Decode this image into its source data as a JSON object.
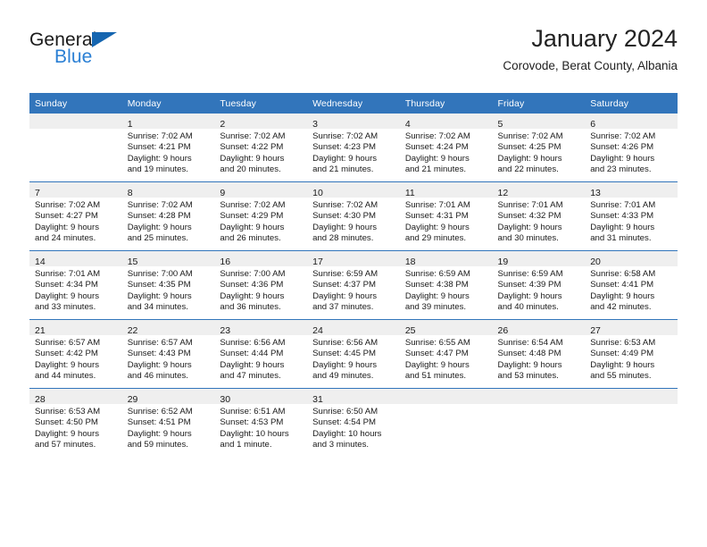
{
  "brand": {
    "name_part1": "General",
    "name_part2": "Blue",
    "triangle_icon": "triangle-icon",
    "blue": "#2a7fd4",
    "dark_blue": "#1565b0"
  },
  "header": {
    "title": "January 2024",
    "subtitle": "Corovode, Berat County, Albania"
  },
  "colors": {
    "header_blue": "#3275bb",
    "daynum_band": "#efefef",
    "text": "#1a1a1a"
  },
  "calendar": {
    "weekday_headers": [
      "Sunday",
      "Monday",
      "Tuesday",
      "Wednesday",
      "Thursday",
      "Friday",
      "Saturday"
    ],
    "weeks": [
      [
        {
          "day": "",
          "sunrise": "",
          "sunset": "",
          "daylight_line1": "",
          "daylight_line2": ""
        },
        {
          "day": "1",
          "sunrise": "Sunrise: 7:02 AM",
          "sunset": "Sunset: 4:21 PM",
          "daylight_line1": "Daylight: 9 hours",
          "daylight_line2": "and 19 minutes."
        },
        {
          "day": "2",
          "sunrise": "Sunrise: 7:02 AM",
          "sunset": "Sunset: 4:22 PM",
          "daylight_line1": "Daylight: 9 hours",
          "daylight_line2": "and 20 minutes."
        },
        {
          "day": "3",
          "sunrise": "Sunrise: 7:02 AM",
          "sunset": "Sunset: 4:23 PM",
          "daylight_line1": "Daylight: 9 hours",
          "daylight_line2": "and 21 minutes."
        },
        {
          "day": "4",
          "sunrise": "Sunrise: 7:02 AM",
          "sunset": "Sunset: 4:24 PM",
          "daylight_line1": "Daylight: 9 hours",
          "daylight_line2": "and 21 minutes."
        },
        {
          "day": "5",
          "sunrise": "Sunrise: 7:02 AM",
          "sunset": "Sunset: 4:25 PM",
          "daylight_line1": "Daylight: 9 hours",
          "daylight_line2": "and 22 minutes."
        },
        {
          "day": "6",
          "sunrise": "Sunrise: 7:02 AM",
          "sunset": "Sunset: 4:26 PM",
          "daylight_line1": "Daylight: 9 hours",
          "daylight_line2": "and 23 minutes."
        }
      ],
      [
        {
          "day": "7",
          "sunrise": "Sunrise: 7:02 AM",
          "sunset": "Sunset: 4:27 PM",
          "daylight_line1": "Daylight: 9 hours",
          "daylight_line2": "and 24 minutes."
        },
        {
          "day": "8",
          "sunrise": "Sunrise: 7:02 AM",
          "sunset": "Sunset: 4:28 PM",
          "daylight_line1": "Daylight: 9 hours",
          "daylight_line2": "and 25 minutes."
        },
        {
          "day": "9",
          "sunrise": "Sunrise: 7:02 AM",
          "sunset": "Sunset: 4:29 PM",
          "daylight_line1": "Daylight: 9 hours",
          "daylight_line2": "and 26 minutes."
        },
        {
          "day": "10",
          "sunrise": "Sunrise: 7:02 AM",
          "sunset": "Sunset: 4:30 PM",
          "daylight_line1": "Daylight: 9 hours",
          "daylight_line2": "and 28 minutes."
        },
        {
          "day": "11",
          "sunrise": "Sunrise: 7:01 AM",
          "sunset": "Sunset: 4:31 PM",
          "daylight_line1": "Daylight: 9 hours",
          "daylight_line2": "and 29 minutes."
        },
        {
          "day": "12",
          "sunrise": "Sunrise: 7:01 AM",
          "sunset": "Sunset: 4:32 PM",
          "daylight_line1": "Daylight: 9 hours",
          "daylight_line2": "and 30 minutes."
        },
        {
          "day": "13",
          "sunrise": "Sunrise: 7:01 AM",
          "sunset": "Sunset: 4:33 PM",
          "daylight_line1": "Daylight: 9 hours",
          "daylight_line2": "and 31 minutes."
        }
      ],
      [
        {
          "day": "14",
          "sunrise": "Sunrise: 7:01 AM",
          "sunset": "Sunset: 4:34 PM",
          "daylight_line1": "Daylight: 9 hours",
          "daylight_line2": "and 33 minutes."
        },
        {
          "day": "15",
          "sunrise": "Sunrise: 7:00 AM",
          "sunset": "Sunset: 4:35 PM",
          "daylight_line1": "Daylight: 9 hours",
          "daylight_line2": "and 34 minutes."
        },
        {
          "day": "16",
          "sunrise": "Sunrise: 7:00 AM",
          "sunset": "Sunset: 4:36 PM",
          "daylight_line1": "Daylight: 9 hours",
          "daylight_line2": "and 36 minutes."
        },
        {
          "day": "17",
          "sunrise": "Sunrise: 6:59 AM",
          "sunset": "Sunset: 4:37 PM",
          "daylight_line1": "Daylight: 9 hours",
          "daylight_line2": "and 37 minutes."
        },
        {
          "day": "18",
          "sunrise": "Sunrise: 6:59 AM",
          "sunset": "Sunset: 4:38 PM",
          "daylight_line1": "Daylight: 9 hours",
          "daylight_line2": "and 39 minutes."
        },
        {
          "day": "19",
          "sunrise": "Sunrise: 6:59 AM",
          "sunset": "Sunset: 4:39 PM",
          "daylight_line1": "Daylight: 9 hours",
          "daylight_line2": "and 40 minutes."
        },
        {
          "day": "20",
          "sunrise": "Sunrise: 6:58 AM",
          "sunset": "Sunset: 4:41 PM",
          "daylight_line1": "Daylight: 9 hours",
          "daylight_line2": "and 42 minutes."
        }
      ],
      [
        {
          "day": "21",
          "sunrise": "Sunrise: 6:57 AM",
          "sunset": "Sunset: 4:42 PM",
          "daylight_line1": "Daylight: 9 hours",
          "daylight_line2": "and 44 minutes."
        },
        {
          "day": "22",
          "sunrise": "Sunrise: 6:57 AM",
          "sunset": "Sunset: 4:43 PM",
          "daylight_line1": "Daylight: 9 hours",
          "daylight_line2": "and 46 minutes."
        },
        {
          "day": "23",
          "sunrise": "Sunrise: 6:56 AM",
          "sunset": "Sunset: 4:44 PM",
          "daylight_line1": "Daylight: 9 hours",
          "daylight_line2": "and 47 minutes."
        },
        {
          "day": "24",
          "sunrise": "Sunrise: 6:56 AM",
          "sunset": "Sunset: 4:45 PM",
          "daylight_line1": "Daylight: 9 hours",
          "daylight_line2": "and 49 minutes."
        },
        {
          "day": "25",
          "sunrise": "Sunrise: 6:55 AM",
          "sunset": "Sunset: 4:47 PM",
          "daylight_line1": "Daylight: 9 hours",
          "daylight_line2": "and 51 minutes."
        },
        {
          "day": "26",
          "sunrise": "Sunrise: 6:54 AM",
          "sunset": "Sunset: 4:48 PM",
          "daylight_line1": "Daylight: 9 hours",
          "daylight_line2": "and 53 minutes."
        },
        {
          "day": "27",
          "sunrise": "Sunrise: 6:53 AM",
          "sunset": "Sunset: 4:49 PM",
          "daylight_line1": "Daylight: 9 hours",
          "daylight_line2": "and 55 minutes."
        }
      ],
      [
        {
          "day": "28",
          "sunrise": "Sunrise: 6:53 AM",
          "sunset": "Sunset: 4:50 PM",
          "daylight_line1": "Daylight: 9 hours",
          "daylight_line2": "and 57 minutes."
        },
        {
          "day": "29",
          "sunrise": "Sunrise: 6:52 AM",
          "sunset": "Sunset: 4:51 PM",
          "daylight_line1": "Daylight: 9 hours",
          "daylight_line2": "and 59 minutes."
        },
        {
          "day": "30",
          "sunrise": "Sunrise: 6:51 AM",
          "sunset": "Sunset: 4:53 PM",
          "daylight_line1": "Daylight: 10 hours",
          "daylight_line2": "and 1 minute."
        },
        {
          "day": "31",
          "sunrise": "Sunrise: 6:50 AM",
          "sunset": "Sunset: 4:54 PM",
          "daylight_line1": "Daylight: 10 hours",
          "daylight_line2": "and 3 minutes."
        },
        {
          "day": "",
          "sunrise": "",
          "sunset": "",
          "daylight_line1": "",
          "daylight_line2": ""
        },
        {
          "day": "",
          "sunrise": "",
          "sunset": "",
          "daylight_line1": "",
          "daylight_line2": ""
        },
        {
          "day": "",
          "sunrise": "",
          "sunset": "",
          "daylight_line1": "",
          "daylight_line2": ""
        }
      ]
    ]
  }
}
